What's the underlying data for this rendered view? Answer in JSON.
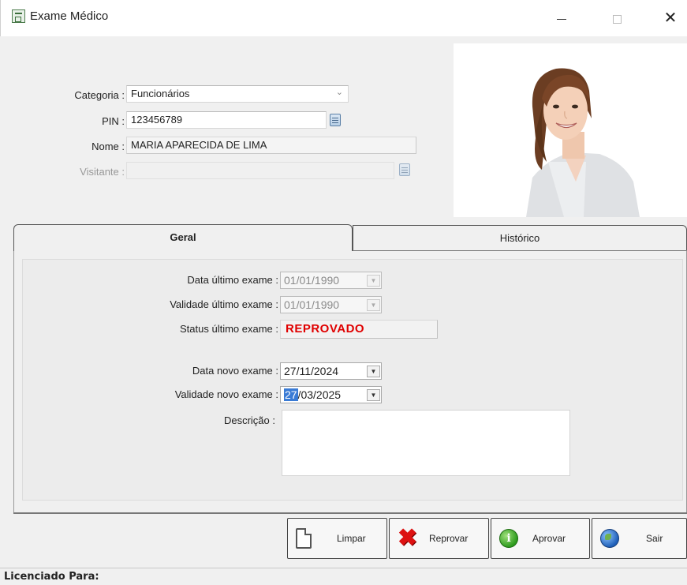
{
  "window": {
    "title": "Exame Médico",
    "minimize_glyph": "—",
    "close_glyph": "✕"
  },
  "header": {
    "categoria_label": "Categoria :",
    "categoria_value": "Funcionários",
    "pin_label": "PIN :",
    "pin_value": "123456789",
    "nome_label": "Nome :",
    "nome_value": "MARIA APARECIDA DE LIMA",
    "visitante_label": "Visitante :",
    "visitante_value": ""
  },
  "tabs": [
    {
      "label": "Geral",
      "active": true
    },
    {
      "label": "Histórico",
      "active": false
    }
  ],
  "geral": {
    "data_ultimo_label": "Data último exame :",
    "data_ultimo_value": "01/01/1990",
    "validade_ultimo_label": "Validade último exame :",
    "validade_ultimo_value": "01/01/1990",
    "status_ultimo_label": "Status último exame :",
    "status_ultimo_value": "REPROVADO",
    "data_novo_label": "Data novo exame :",
    "data_novo_value": "27/11/2024",
    "validade_novo_label": "Validade novo exame :",
    "validade_novo_day": "27",
    "validade_novo_rest": "/03/2025",
    "descricao_label": "Descrição :",
    "descricao_value": ""
  },
  "buttons": {
    "limpar": "Limpar",
    "reprovar": "Reprovar",
    "aprovar": "Aprovar",
    "sair": "Sair"
  },
  "status_bar": {
    "text": "Licenciado Para:"
  },
  "colors": {
    "status_reprovado": "#e00000",
    "selection": "#3a7bd5"
  },
  "icons": [
    "app-icon",
    "lookup-icon",
    "calendar-dropdown-icon",
    "document-icon",
    "red-x-icon",
    "green-info-icon",
    "globe-icon"
  ]
}
